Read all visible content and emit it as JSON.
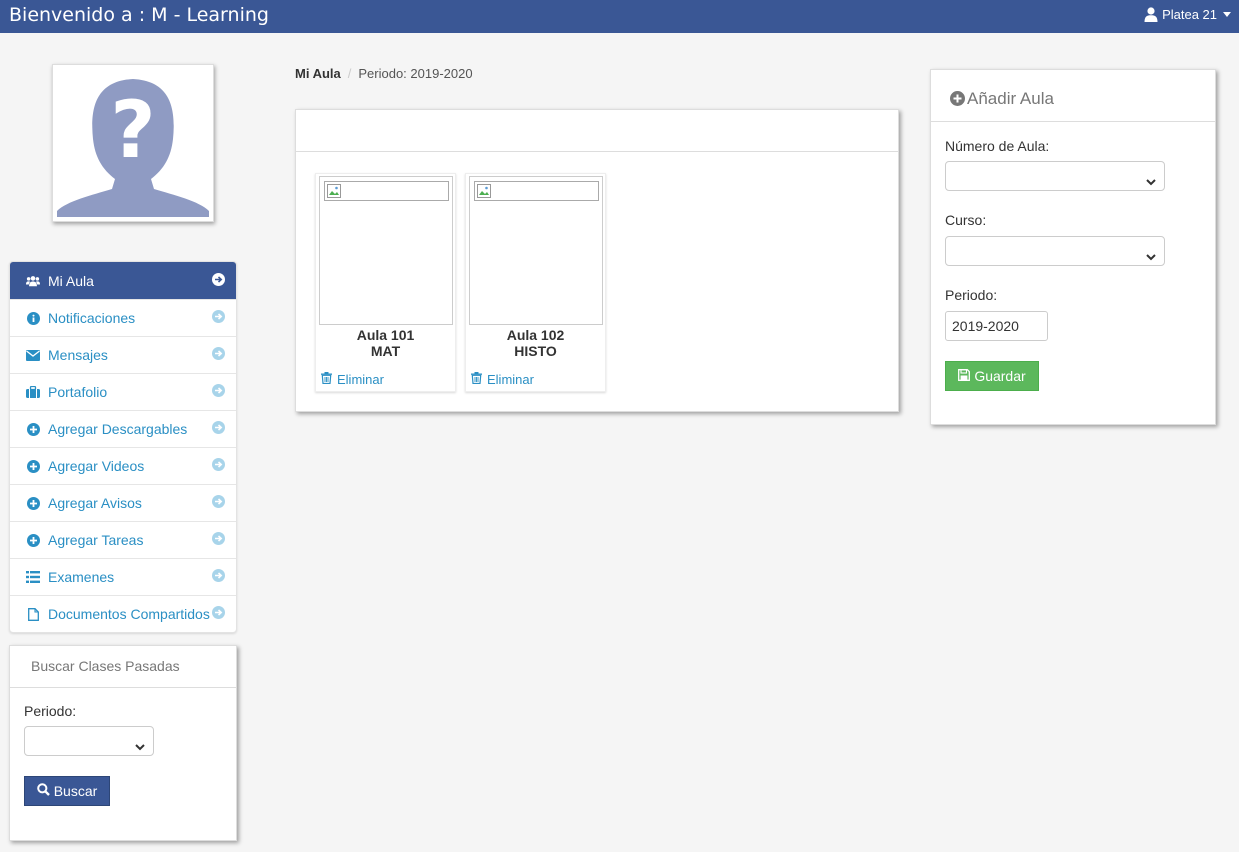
{
  "header": {
    "title": "Bienvenido a : M - Learning",
    "user_name": "Platea 21"
  },
  "sidebar": {
    "items": [
      {
        "label": "Mi Aula",
        "icon": "users-icon",
        "active": true
      },
      {
        "label": "Notificaciones",
        "icon": "info-icon"
      },
      {
        "label": "Mensajes",
        "icon": "envelope-icon"
      },
      {
        "label": "Portafolio",
        "icon": "briefcase-icon"
      },
      {
        "label": "Agregar Descargables",
        "icon": "plus-circle-icon"
      },
      {
        "label": "Agregar Videos",
        "icon": "plus-circle-icon"
      },
      {
        "label": "Agregar Avisos",
        "icon": "plus-circle-icon"
      },
      {
        "label": "Agregar Tareas",
        "icon": "plus-circle-icon"
      },
      {
        "label": "Examenes",
        "icon": "list-icon"
      },
      {
        "label": "Documentos Compartidos",
        "icon": "file-icon"
      }
    ]
  },
  "search_panel": {
    "title": "Buscar Clases Pasadas",
    "periodo_label": "Periodo:",
    "periodo_value": "",
    "button_label": "Buscar"
  },
  "breadcrumb": {
    "item1": "Mi Aula",
    "item2": "Periodo: 2019-2020"
  },
  "classrooms": [
    {
      "name": "Aula 101",
      "course": "MAT",
      "delete_label": "Eliminar"
    },
    {
      "name": "Aula 102",
      "course": "HISTO",
      "delete_label": "Eliminar"
    }
  ],
  "add_panel": {
    "title": "Añadir Aula",
    "numero_label": "Número de Aula:",
    "numero_value": "",
    "curso_label": "Curso:",
    "curso_value": "",
    "periodo_label": "Periodo:",
    "periodo_value": "2019-2020",
    "button_label": "Guardar"
  },
  "colors": {
    "primary": "#3a5795",
    "link": "#2a8fc4",
    "success": "#5cb85c"
  }
}
